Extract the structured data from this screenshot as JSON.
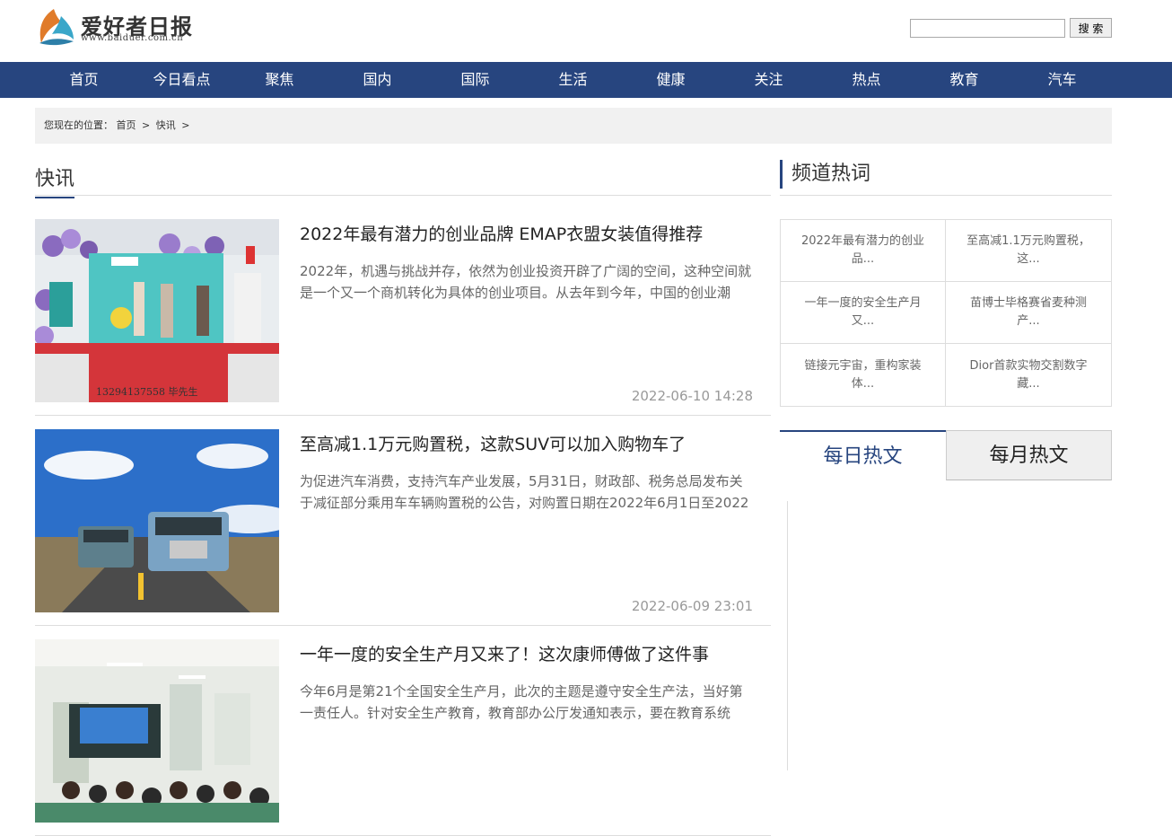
{
  "header": {
    "logo_name": "爱好者日报",
    "logo_url": "www.baiduer.com.cn",
    "search_placeholder": "",
    "search_button": "搜 索"
  },
  "nav": [
    "首页",
    "今日看点",
    "聚焦",
    "国内",
    "国际",
    "生活",
    "健康",
    "关注",
    "热点",
    "教育",
    "汽车"
  ],
  "breadcrumb": {
    "prefix": "您现在的位置：",
    "home": "首页",
    "current": "快讯",
    "sep": ">"
  },
  "main": {
    "section_title": "快讯",
    "articles": [
      {
        "title": "2022年最有潜力的创业品牌 EMAP衣盟女装值得推荐",
        "summary": "2022年，机遇与挑战并存，依然为创业投资开辟了广阔的空间，这种空间就是一个又一个商机转化为具体的创业项目。从去年到今年，中国的创业潮",
        "date": "2022-06-10 14:28",
        "image_caption": "13294137558    毕先生"
      },
      {
        "title": "至高减1.1万元购置税，这款SUV可以加入购物车了",
        "summary": "为促进汽车消费，支持汽车产业发展，5月31日，财政部、税务总局发布关于减征部分乘用车车辆购置税的公告，对购置日期在2022年6月1日至2022",
        "date": "2022-06-09 23:01"
      },
      {
        "title": "一年一度的安全生产月又来了！这次康师傅做了这件事",
        "summary": "今年6月是第21个全国安全生产月，此次的主题是遵守安全生产法，当好第一责任人。针对安全生产教育，教育部办公厅发通知表示，要在教育系统",
        "date": ""
      }
    ]
  },
  "sidebar": {
    "title": "频道热词",
    "hotwords": [
      "2022年最有潜力的创业品...",
      "至高减1.1万元购置税，这...",
      "一年一度的安全生产月又...",
      "苗博士毕格赛省麦种测产...",
      "链接元宇宙，重构家装体...",
      "Dior首款实物交割数字藏..."
    ],
    "tabs": [
      "每日热文",
      "每月热文"
    ]
  },
  "colors": {
    "nav_bg": "#27457f",
    "accent": "#27457f",
    "breadcrumb_bg": "#f1f1f1"
  }
}
